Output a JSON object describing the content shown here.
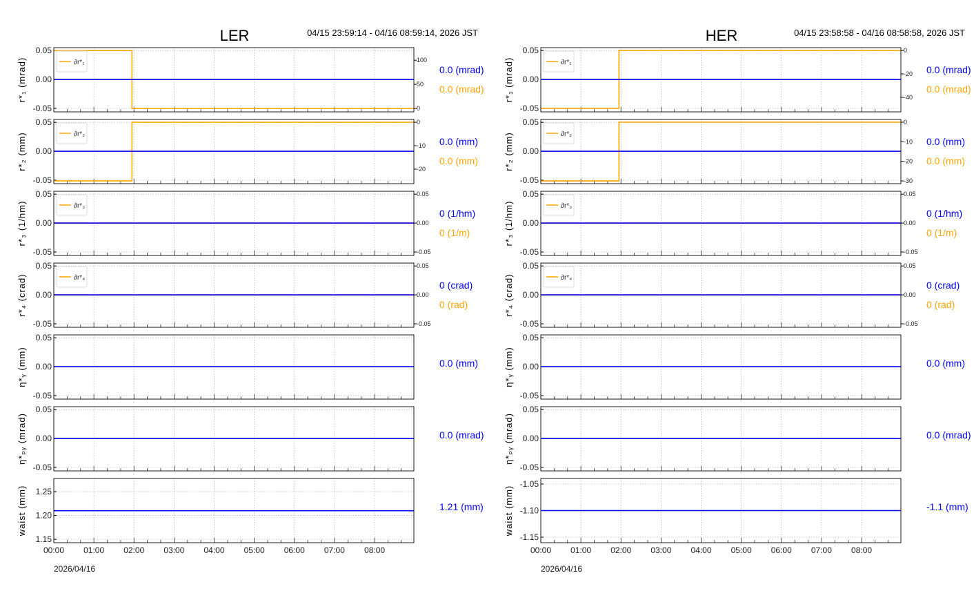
{
  "colors": {
    "primary": "#0000ff",
    "secondary": "#ffa500",
    "grid": "#bbbbbb"
  },
  "chart_data": [
    {
      "type": "line",
      "title": "LER",
      "time_range": "04/15 23:59:14 - 04/16 08:59:14, 2026 JST",
      "date_label": "2026/04/16",
      "xlim_hours": [
        0,
        8.98
      ],
      "x_tick_labels": [
        "00:00",
        "01:00",
        "02:00",
        "03:00",
        "04:00",
        "05:00",
        "06:00",
        "07:00",
        "08:00"
      ],
      "grid": true,
      "panels": [
        {
          "ylabel": "r*₁ (mrad)",
          "ylim": [
            -0.056,
            0.055
          ],
          "yticks": [
            "0.05",
            "0.00",
            "-0.05"
          ],
          "ytick_values": [
            0.05,
            0,
            -0.05
          ],
          "series": {
            "name": "r*₁",
            "x": [
              0,
              8.98
            ],
            "y": [
              0,
              0
            ]
          },
          "secondary": {
            "legend": "∂r*₁",
            "ylim": [
              -7,
              126
            ],
            "yticks": [
              "100",
              "50",
              "0"
            ],
            "ytick_values": [
              100,
              50,
              0
            ],
            "x": [
              0,
              1.95,
              1.95,
              8.98
            ],
            "y": [
              120,
              120,
              0,
              0
            ]
          },
          "value_labels": [
            {
              "text": "0.0 (mrad)",
              "color": "primary"
            },
            {
              "text": "0.0 (mrad)",
              "color": "secondary"
            }
          ]
        },
        {
          "ylabel": "r*₂ (mm)",
          "ylim": [
            -0.056,
            0.055
          ],
          "yticks": [
            "0.05",
            "0.00",
            "-0.05"
          ],
          "ytick_values": [
            0.05,
            0,
            -0.05
          ],
          "series": {
            "name": "r*₂",
            "x": [
              0,
              8.98
            ],
            "y": [
              0,
              0
            ]
          },
          "secondary": {
            "legend": "∂r*₂",
            "ylim": [
              -26.2,
              1.2
            ],
            "yticks": [
              "0",
              "-10",
              "-20"
            ],
            "ytick_values": [
              0,
              -10,
              -20
            ],
            "x": [
              0,
              1.95,
              1.95,
              8.98
            ],
            "y": [
              -25,
              -25,
              0,
              0
            ]
          },
          "value_labels": [
            {
              "text": "0.0 (mm)",
              "color": "primary"
            },
            {
              "text": "0.0 (mm)",
              "color": "secondary"
            }
          ]
        },
        {
          "ylabel": "r*₃ (1/hm)",
          "ylim": [
            -0.056,
            0.055
          ],
          "yticks": [
            "0.05",
            "0.00",
            "-0.05"
          ],
          "ytick_values": [
            0.05,
            0,
            -0.05
          ],
          "series": {
            "name": "r*₃",
            "x": [
              0,
              8.98
            ],
            "y": [
              0,
              0
            ]
          },
          "secondary": {
            "legend": "∂r*₃",
            "ylim": [
              -0.056,
              0.055
            ],
            "yticks": [
              "0.05",
              "0.00",
              "-0.05"
            ],
            "ytick_values": [
              0.05,
              0,
              -0.05
            ],
            "x": [
              0,
              8.98
            ],
            "y": [
              0,
              0
            ]
          },
          "value_labels": [
            {
              "text": "0 (1/hm)",
              "color": "primary"
            },
            {
              "text": "0 (1/m)",
              "color": "secondary"
            }
          ]
        },
        {
          "ylabel": "r*₄ (crad)",
          "ylim": [
            -0.056,
            0.055
          ],
          "yticks": [
            "0.05",
            "0.00",
            "-0.05"
          ],
          "ytick_values": [
            0.05,
            0,
            -0.05
          ],
          "series": {
            "name": "r*₄",
            "x": [
              0,
              8.98
            ],
            "y": [
              0,
              0
            ]
          },
          "secondary": {
            "legend": "∂r*₄",
            "ylim": [
              -0.056,
              0.055
            ],
            "yticks": [
              "0.05",
              "0.00",
              "-0.05"
            ],
            "ytick_values": [
              0.05,
              0,
              -0.05
            ],
            "x": [
              0,
              8.98
            ],
            "y": [
              0,
              0
            ]
          },
          "value_labels": [
            {
              "text": "0 (crad)",
              "color": "primary"
            },
            {
              "text": "0 (rad)",
              "color": "secondary"
            }
          ]
        },
        {
          "ylabel": "η*ᵧ (mm)",
          "ylim": [
            -0.056,
            0.055
          ],
          "yticks": [
            "0.05",
            "0.00",
            "-0.05"
          ],
          "ytick_values": [
            0.05,
            0,
            -0.05
          ],
          "series": {
            "name": "η*y",
            "x": [
              0,
              8.98
            ],
            "y": [
              0,
              0
            ]
          },
          "value_labels": [
            {
              "text": "0.0 (mm)",
              "color": "primary"
            }
          ]
        },
        {
          "ylabel": "η*ₚᵧ (mrad)",
          "ylim": [
            -0.056,
            0.055
          ],
          "yticks": [
            "0.05",
            "0.00",
            "-0.05"
          ],
          "ytick_values": [
            0.05,
            0,
            -0.05
          ],
          "series": {
            "name": "η*py",
            "x": [
              0,
              8.98
            ],
            "y": [
              0,
              0
            ]
          },
          "value_labels": [
            {
              "text": "0.0 (mrad)",
              "color": "primary"
            }
          ]
        },
        {
          "ylabel": "waist (mm)",
          "ylim": [
            1.143,
            1.2775
          ],
          "yticks": [
            "1.25",
            "1.20",
            "1.15"
          ],
          "ytick_values": [
            1.25,
            1.2,
            1.15
          ],
          "series": {
            "name": "waist",
            "x": [
              0,
              8.98
            ],
            "y": [
              1.21,
              1.21
            ]
          },
          "value_labels": [
            {
              "text": "1.21 (mm)",
              "color": "primary"
            }
          ]
        }
      ]
    },
    {
      "type": "line",
      "title": "HER",
      "time_range": "04/15 23:58:58 - 04/16 08:58:58, 2026 JST",
      "date_label": "2026/04/16",
      "xlim_hours": [
        0,
        8.98
      ],
      "x_tick_labels": [
        "00:00",
        "01:00",
        "02:00",
        "03:00",
        "04:00",
        "05:00",
        "06:00",
        "07:00",
        "08:00"
      ],
      "grid": true,
      "panels": [
        {
          "ylabel": "r*₁ (mrad)",
          "ylim": [
            -0.056,
            0.055
          ],
          "yticks": [
            "0.05",
            "0.00",
            "-0.05"
          ],
          "ytick_values": [
            0.05,
            0,
            -0.05
          ],
          "series": {
            "name": "r*₁",
            "x": [
              0,
              8.98
            ],
            "y": [
              0,
              0
            ]
          },
          "secondary": {
            "legend": "∂r*₁",
            "ylim": [
              -52.4,
              2.4
            ],
            "yticks": [
              "0",
              "-20",
              "-40"
            ],
            "ytick_values": [
              0,
              -20,
              -40
            ],
            "x": [
              0,
              1.95,
              1.95,
              8.98
            ],
            "y": [
              -49.4,
              -49.4,
              0,
              0
            ]
          },
          "value_labels": [
            {
              "text": "0.0 (mrad)",
              "color": "primary"
            },
            {
              "text": "0.0 (mrad)",
              "color": "secondary"
            }
          ]
        },
        {
          "ylabel": "r*₂ (mm)",
          "ylim": [
            -0.056,
            0.055
          ],
          "yticks": [
            "0.05",
            "0.00",
            "-0.05"
          ],
          "ytick_values": [
            0.05,
            0,
            -0.05
          ],
          "series": {
            "name": "r*₂",
            "x": [
              0,
              8.98
            ],
            "y": [
              0,
              0
            ]
          },
          "secondary": {
            "legend": "∂r*₂",
            "ylim": [
              -31.4,
              1.4
            ],
            "yticks": [
              "0",
              "-10",
              "-20",
              "-30"
            ],
            "ytick_values": [
              0,
              -10,
              -20,
              -30
            ],
            "x": [
              0,
              1.95,
              1.95,
              8.98
            ],
            "y": [
              -30,
              -30,
              0,
              0
            ]
          },
          "value_labels": [
            {
              "text": "0.0 (mm)",
              "color": "primary"
            },
            {
              "text": "0.0 (mm)",
              "color": "secondary"
            }
          ]
        },
        {
          "ylabel": "r*₃ (1/hm)",
          "ylim": [
            -0.056,
            0.055
          ],
          "yticks": [
            "0.05",
            "0.00",
            "-0.05"
          ],
          "ytick_values": [
            0.05,
            0,
            -0.05
          ],
          "series": {
            "name": "r*₃",
            "x": [
              0,
              8.98
            ],
            "y": [
              0,
              0
            ]
          },
          "secondary": {
            "legend": "∂r*₃",
            "ylim": [
              -0.056,
              0.055
            ],
            "yticks": [
              "0.05",
              "0.00",
              "-0.05"
            ],
            "ytick_values": [
              0.05,
              0,
              -0.05
            ],
            "x": [
              0,
              8.98
            ],
            "y": [
              0,
              0
            ]
          },
          "value_labels": [
            {
              "text": "0 (1/hm)",
              "color": "primary"
            },
            {
              "text": "0 (1/m)",
              "color": "secondary"
            }
          ]
        },
        {
          "ylabel": "r*₄ (crad)",
          "ylim": [
            -0.056,
            0.055
          ],
          "yticks": [
            "0.05",
            "0.00",
            "-0.05"
          ],
          "ytick_values": [
            0.05,
            0,
            -0.05
          ],
          "series": {
            "name": "r*₄",
            "x": [
              0,
              8.98
            ],
            "y": [
              0,
              0
            ]
          },
          "secondary": {
            "legend": "∂r*₄",
            "ylim": [
              -0.056,
              0.055
            ],
            "yticks": [
              "0.05",
              "0.00",
              "-0.05"
            ],
            "ytick_values": [
              0.05,
              0,
              -0.05
            ],
            "x": [
              0,
              8.98
            ],
            "y": [
              0,
              0
            ]
          },
          "value_labels": [
            {
              "text": "0 (crad)",
              "color": "primary"
            },
            {
              "text": "0 (rad)",
              "color": "secondary"
            }
          ]
        },
        {
          "ylabel": "η*ᵧ (mm)",
          "ylim": [
            -0.056,
            0.055
          ],
          "yticks": [
            "0.05",
            "0.00",
            "-0.05"
          ],
          "ytick_values": [
            0.05,
            0,
            -0.05
          ],
          "series": {
            "name": "η*y",
            "x": [
              0,
              8.98
            ],
            "y": [
              0,
              0
            ]
          },
          "value_labels": [
            {
              "text": "0.0 (mm)",
              "color": "primary"
            }
          ]
        },
        {
          "ylabel": "η*ₚᵧ (mrad)",
          "ylim": [
            -0.056,
            0.055
          ],
          "yticks": [
            "0.05",
            "0.00",
            "-0.05"
          ],
          "ytick_values": [
            0.05,
            0,
            -0.05
          ],
          "series": {
            "name": "η*py",
            "x": [
              0,
              8.98
            ],
            "y": [
              0,
              0
            ]
          },
          "value_labels": [
            {
              "text": "0.0 (mrad)",
              "color": "primary"
            }
          ]
        },
        {
          "ylabel": "waist (mm)",
          "ylim": [
            -1.1604,
            -1.0396
          ],
          "yticks": [
            "-1.05",
            "-1.10",
            "-1.15"
          ],
          "ytick_values": [
            -1.05,
            -1.1,
            -1.15
          ],
          "series": {
            "name": "waist",
            "x": [
              0,
              8.98
            ],
            "y": [
              -1.1,
              -1.1
            ]
          },
          "value_labels": [
            {
              "text": "-1.1 (mm)",
              "color": "primary"
            }
          ]
        }
      ]
    }
  ]
}
